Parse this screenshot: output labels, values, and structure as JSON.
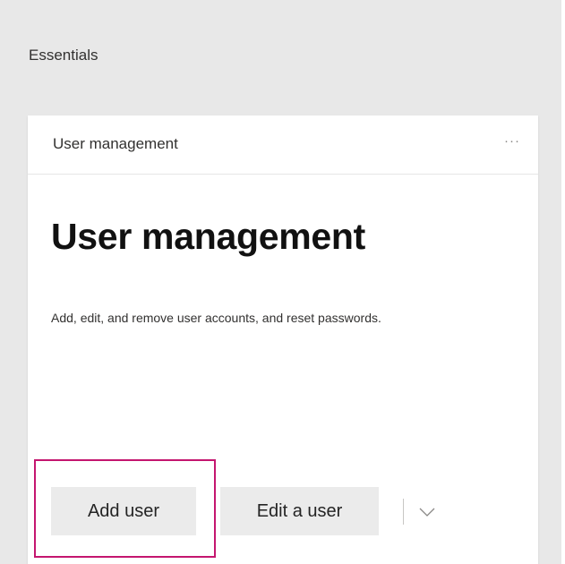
{
  "section": {
    "title": "Essentials"
  },
  "card": {
    "header_title": "User management",
    "more_label": "···",
    "heading": "User management",
    "description": "Add, edit, and remove user accounts, and reset passwords.",
    "actions": {
      "add_user": "Add user",
      "edit_user": "Edit a user"
    },
    "more_actions_icon": "chevron-down-icon"
  },
  "colors": {
    "panel_background": "#e8e8e8",
    "focus_highlight": "#c4166f",
    "button_background": "#ebebeb"
  }
}
